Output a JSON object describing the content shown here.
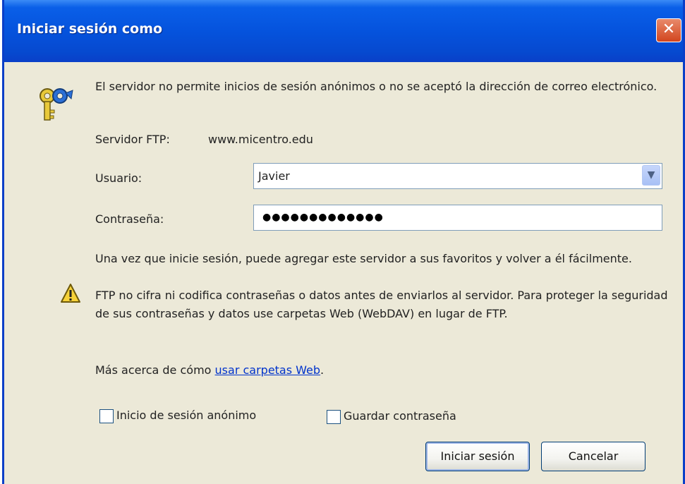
{
  "window": {
    "title": "Iniciar sesión como",
    "close_symbol": "✕"
  },
  "message": "El servidor no permite inicios de sesión anónimos o no se aceptó la  dirección de correo electrónico.",
  "server": {
    "label": "Servidor FTP:",
    "value": "www.micentro.edu"
  },
  "user": {
    "label": "Usuario:",
    "value": "Javier"
  },
  "password": {
    "label": "Contraseña:",
    "mask": "●●●●●●●●●●●●●"
  },
  "info": {
    "line1": "Una vez que inicie sesión, puede agregar este servidor a sus favoritos y volver a él fácilmente.",
    "line2": "FTP no cifra ni codifica contraseñas o datos antes de enviarlos al servidor.  Para proteger la seguridad de sus contraseñas y datos use carpetas Web (WebDAV) en lugar de FTP."
  },
  "more": {
    "prefix": "Más acerca de cómo ",
    "link": "usar carpetas Web",
    "suffix": "."
  },
  "checkboxes": {
    "anonymous": "Inicio de sesión anónimo",
    "save_password": "Guardar contraseña"
  },
  "buttons": {
    "login": "Iniciar sesión",
    "cancel": "Cancelar"
  },
  "icons": {
    "keys": "keys-icon",
    "warning": "warning-icon",
    "dropdown": "chevron-down-icon"
  }
}
